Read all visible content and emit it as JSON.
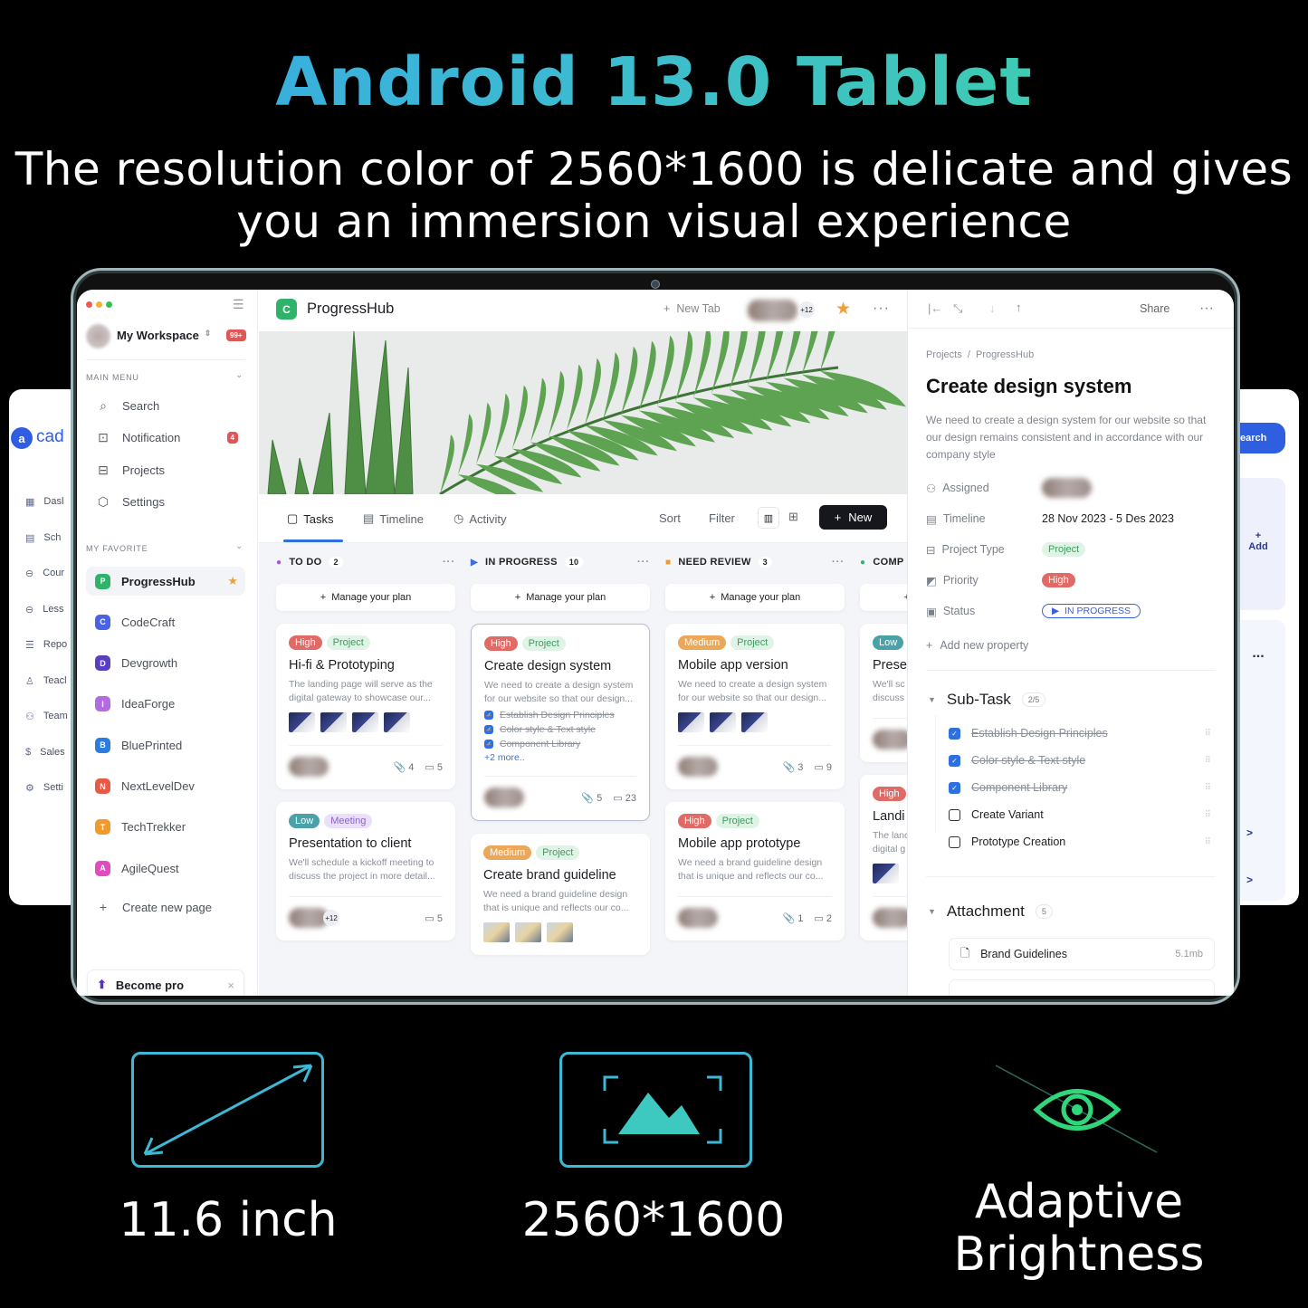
{
  "banner": {
    "headline": "Android 13.0 Tablet",
    "subtitle_line1": "The resolution color of 2560*1600 is delicate and gives",
    "subtitle_line2": "you an immersion visual experience"
  },
  "features": [
    {
      "icon": "diagonal-arrow-icon",
      "label": "11.6 inch"
    },
    {
      "icon": "image-resolution-icon",
      "label": "2560*1600"
    },
    {
      "icon": "eye-icon",
      "label_line1": "Adaptive",
      "label_line2": "Brightness"
    }
  ],
  "background_app_left": {
    "logo_text": "cad",
    "nav": [
      "Dasl",
      "Sch",
      "Cour",
      "Less",
      "Repo",
      "Teacl",
      "Team",
      "Sales",
      "Setti"
    ]
  },
  "background_app_right": {
    "search_label": "earch",
    "add_label": "Add",
    "add_icon": "+",
    "more_icon": "..."
  },
  "sidebar": {
    "workspace": "My Workspace",
    "workspace_badge": "99+",
    "main_menu_label": "MAIN MENU",
    "main_menu": [
      {
        "label": "Search",
        "icon": "search-icon"
      },
      {
        "label": "Notification",
        "icon": "notification-icon",
        "badge": "4"
      },
      {
        "label": "Projects",
        "icon": "briefcase-icon"
      },
      {
        "label": "Settings",
        "icon": "settings-icon"
      }
    ],
    "favorite_label": "MY FAVORITE",
    "favorites": [
      {
        "label": "ProgressHub",
        "color": "#2fb36b",
        "active": true
      },
      {
        "label": "CodeCraft",
        "color": "#4a63e6"
      },
      {
        "label": "Devgrowth",
        "color": "#5a3fc0"
      },
      {
        "label": "IdeaForge",
        "color": "#b36be0"
      },
      {
        "label": "BluePrinted",
        "color": "#2b7be0"
      },
      {
        "label": "NextLevelDev",
        "color": "#e85a45"
      },
      {
        "label": "TechTrekker",
        "color": "#ee9a2d"
      },
      {
        "label": "AgileQuest",
        "color": "#e04cc0"
      }
    ],
    "create_page": "Create new page",
    "become_pro": "Become pro"
  },
  "header": {
    "app_name": "ProgressHub",
    "new_tab": "New Tab",
    "avatar_extra": "+12",
    "accent": "#2fb36b"
  },
  "tabs": {
    "items": [
      {
        "label": "Tasks",
        "active": true
      },
      {
        "label": "Timeline"
      },
      {
        "label": "Activity"
      }
    ],
    "sort": "Sort",
    "filter": "Filter",
    "new_button": "New"
  },
  "board": {
    "manage_label": "Manage your plan",
    "columns": [
      {
        "title": "TO DO",
        "count": "2",
        "color": "#b04ee0",
        "marker": "dot",
        "cards": [
          {
            "tags": [
              {
                "text": "High",
                "kind": "high"
              },
              {
                "text": "Project",
                "kind": "project"
              }
            ],
            "title": "Hi-fi & Prototyping",
            "desc": [
              "The landing page will serve as the",
              "digital gateway to showcase our..."
            ],
            "thumbs": 4,
            "attachments": "4",
            "comments": "5"
          },
          {
            "tags": [
              {
                "text": "Low",
                "kind": "low"
              },
              {
                "text": "Meeting",
                "kind": "meeting"
              }
            ],
            "title": "Presentation to client",
            "desc": [
              "We'll schedule a kickoff meeting to",
              "discuss the project in more detail..."
            ],
            "extra": "+12",
            "comments": "5"
          }
        ]
      },
      {
        "title": "IN PROGRESS",
        "count": "10",
        "color": "#3a6ee0",
        "marker": "play",
        "cards": [
          {
            "selected": true,
            "tags": [
              {
                "text": "High",
                "kind": "high"
              },
              {
                "text": "Project",
                "kind": "project"
              }
            ],
            "title": "Create design system",
            "desc": [
              "We need to create a design system",
              "for our website so that our design..."
            ],
            "checks": [
              "Establish Design Principles",
              "Color style & Text style",
              "Component Library"
            ],
            "more": "+2 more..",
            "attachments": "5",
            "comments": "23"
          },
          {
            "tags": [
              {
                "text": "Medium",
                "kind": "medium"
              },
              {
                "text": "Project",
                "kind": "project"
              }
            ],
            "title": "Create brand guideline",
            "desc": [
              "We need a brand guideline design",
              "that is unique and reflects our co..."
            ],
            "thumbs": 3,
            "photo": true
          }
        ]
      },
      {
        "title": "NEED REVIEW",
        "count": "3",
        "color": "#ee9a2d",
        "marker": "square",
        "cards": [
          {
            "tags": [
              {
                "text": "Medium",
                "kind": "medium"
              },
              {
                "text": "Project",
                "kind": "project"
              }
            ],
            "title": "Mobile app version",
            "desc": [
              "We need to create a design system",
              "for our website so that our design..."
            ],
            "thumbs": 3,
            "attachments": "3",
            "comments": "9"
          },
          {
            "tags": [
              {
                "text": "High",
                "kind": "high"
              },
              {
                "text": "Project",
                "kind": "project"
              }
            ],
            "title": "Mobile app prototype",
            "desc": [
              "We need a brand guideline design",
              "that is unique and reflects our co..."
            ],
            "attachments": "1",
            "comments": "2"
          }
        ]
      },
      {
        "title": "COMP",
        "color": "#2fb36b",
        "marker": "dot",
        "cards": [
          {
            "tags": [
              {
                "text": "Low",
                "kind": "low"
              }
            ],
            "title": "Prese",
            "desc": [
              "We'll sc",
              "discuss"
            ],
            "avatars_only": true
          },
          {
            "tags": [
              {
                "text": "High",
                "kind": "high"
              }
            ],
            "title": "Landi",
            "desc": [
              "The lanc",
              "digital g"
            ],
            "thumbs": 1,
            "avatars_only": true
          }
        ]
      }
    ]
  },
  "detail": {
    "share": "Share",
    "breadcrumb": [
      "Projects",
      "ProgressHub"
    ],
    "title": "Create design system",
    "description": "We need to create a design system for our website so that our design remains consistent and in accordance with our company style",
    "properties": {
      "assigned": "Assigned",
      "timeline_label": "Timeline",
      "timeline": "28 Nov 2023 - 5 Des 2023",
      "type_label": "Project Type",
      "type": "Project",
      "priority_label": "Priority",
      "priority": "High",
      "status_label": "Status",
      "status": "IN PROGRESS"
    },
    "add_property": "Add new property",
    "subtask_title": "Sub-Task",
    "subtask_count": "2/5",
    "subtasks": [
      {
        "label": "Establish Design Principles",
        "done": true
      },
      {
        "label": "Color style & Text style",
        "done": true
      },
      {
        "label": "Component Library",
        "done": true
      },
      {
        "label": "Create Variant",
        "done": false
      },
      {
        "label": "Prototype Creation",
        "done": false
      }
    ],
    "attachment_title": "Attachment",
    "attachment_count": "5",
    "attachments": [
      {
        "name": "Brand Guidelines",
        "size": "5.1mb"
      }
    ]
  },
  "colors": {
    "high": "#e06a66",
    "project_bg": "#dff3e6",
    "project_fg": "#3f9b5d",
    "medium": "#eba85a",
    "low": "#4aa2a8",
    "meeting_bg": "#ebdffb",
    "meeting_fg": "#8c62c9",
    "status_blue": "#3a5fe0"
  }
}
